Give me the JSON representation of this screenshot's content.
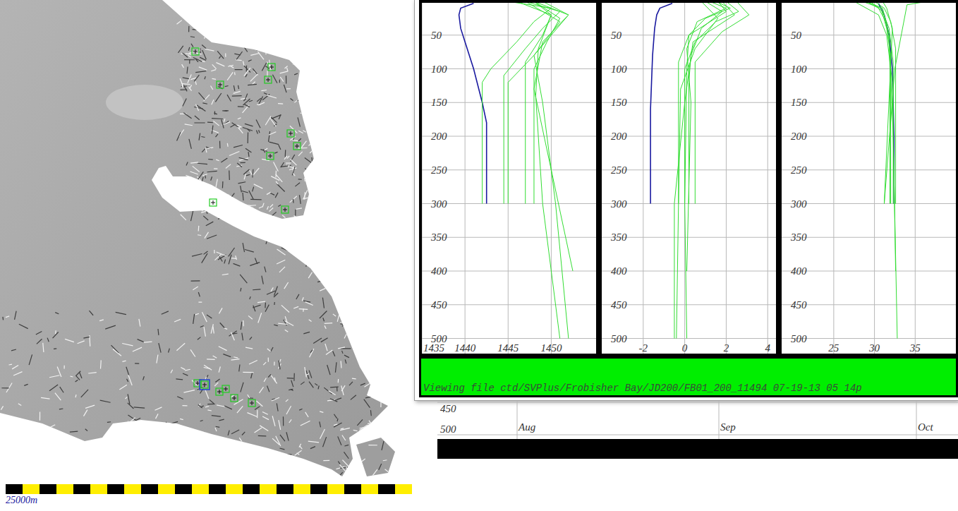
{
  "map": {
    "markers": [
      {
        "selected": false
      },
      {
        "selected": false
      },
      {
        "selected": false
      },
      {
        "selected": false
      },
      {
        "selected": false
      },
      {
        "selected": false
      },
      {
        "selected": false
      },
      {
        "selected": false
      },
      {
        "selected": false
      },
      {
        "selected": false
      },
      {
        "selected": true
      },
      {
        "selected": false
      },
      {
        "selected": false
      },
      {
        "selected": false
      },
      {
        "selected": false
      }
    ],
    "scale_bar": {
      "label": "25000m"
    }
  },
  "profile_window": {
    "panels": [
      {
        "name": "sound-speed",
        "x_min": 1435,
        "x_max": 1455.2,
        "x_ticks": [
          {
            "label": "1435",
            "value": 1435
          },
          {
            "label": "1440",
            "value": 1440
          },
          {
            "label": "1445",
            "value": 1445
          },
          {
            "label": "1450",
            "value": 1450
          }
        ],
        "depth_ticks": [
          "50",
          "100",
          "150",
          "200",
          "250",
          "300",
          "350",
          "400",
          "450",
          "500"
        ],
        "series": [
          {
            "color": "#1a1aa0",
            "depths": [
              3,
              10,
              20,
              40,
              60,
              100,
              150,
              180,
              300
            ],
            "values": [
              1441,
              1439.5,
              1439.3,
              1439.5,
              1440,
              1441,
              1442,
              1442.5,
              1442.5
            ]
          },
          {
            "color": "#33dd33",
            "depths": [
              0,
              10,
              30,
              60,
              100,
              120,
              300
            ],
            "values": [
              1445,
              1450,
              1448,
              1446,
              1443,
              1442,
              1442
            ]
          },
          {
            "color": "#33dd33",
            "depths": [
              0,
              15,
              40,
              70,
              110,
              300
            ],
            "values": [
              1447,
              1451,
              1449,
              1447,
              1444.5,
              1444.5
            ]
          },
          {
            "color": "#33dd33",
            "depths": [
              0,
              20,
              50,
              80,
              120,
              300
            ],
            "values": [
              1448,
              1452,
              1450,
              1448,
              1445,
              1445
            ]
          },
          {
            "color": "#33dd33",
            "depths": [
              0,
              20,
              50,
              90,
              300
            ],
            "values": [
              1446,
              1450,
              1449,
              1447,
              1447
            ]
          },
          {
            "color": "#33dd33",
            "depths": [
              0,
              25,
              60,
              100,
              300
            ],
            "values": [
              1448,
              1451,
              1449.5,
              1448,
              1448
            ]
          },
          {
            "color": "#33dd33",
            "depths": [
              0,
              20,
              60,
              130,
              250,
              400
            ],
            "values": [
              1449,
              1452,
              1449,
              1448,
              1450,
              1452.5
            ]
          },
          {
            "color": "#33dd33",
            "depths": [
              0,
              30,
              80,
              150,
              300,
              500
            ],
            "values": [
              1447,
              1451,
              1448,
              1449,
              1450.5,
              1452
            ]
          },
          {
            "color": "#33dd33",
            "depths": [
              0,
              20,
              70,
              140,
              300,
              500
            ],
            "values": [
              1448,
              1450,
              1448.5,
              1448.2,
              1449,
              1451
            ]
          }
        ]
      },
      {
        "name": "temperature",
        "x_min": -4,
        "x_max": 4.4,
        "x_ticks": [
          {
            "label": "-2",
            "value": -2
          },
          {
            "label": "0",
            "value": 0
          },
          {
            "label": "2",
            "value": 2
          },
          {
            "label": "4",
            "value": 4
          }
        ],
        "depth_ticks": [
          "50",
          "100",
          "150",
          "200",
          "250",
          "300",
          "350",
          "400",
          "450",
          "500"
        ],
        "series": [
          {
            "color": "#1a1aa0",
            "depths": [
              3,
              10,
              20,
              40,
              80,
              120,
              160,
              300
            ],
            "values": [
              -0.6,
              -1.2,
              -1.35,
              -1.45,
              -1.55,
              -1.6,
              -1.65,
              -1.65
            ]
          },
          {
            "color": "#33dd33",
            "depths": [
              0,
              10,
              25,
              50,
              90,
              300
            ],
            "values": [
              1.5,
              2.2,
              1.0,
              0.2,
              -0.3,
              -0.3
            ]
          },
          {
            "color": "#33dd33",
            "depths": [
              0,
              15,
              30,
              60,
              100,
              300
            ],
            "values": [
              2.0,
              2.6,
              1.5,
              0.5,
              0,
              0
            ]
          },
          {
            "color": "#33dd33",
            "depths": [
              0,
              15,
              40,
              80,
              120,
              300
            ],
            "values": [
              1.0,
              1.8,
              0.8,
              0.3,
              0.2,
              0.2
            ]
          },
          {
            "color": "#33dd33",
            "depths": [
              0,
              20,
              45,
              90,
              300
            ],
            "values": [
              2.5,
              3.1,
              1.8,
              0.5,
              0.5
            ]
          },
          {
            "color": "#33dd33",
            "depths": [
              0,
              10,
              30,
              70,
              150,
              400
            ],
            "values": [
              1.2,
              2.0,
              0.6,
              0.1,
              0.3,
              0.1
            ]
          },
          {
            "color": "#33dd33",
            "depths": [
              0,
              20,
              60,
              150,
              300,
              500
            ],
            "values": [
              1.8,
              2.4,
              0.4,
              0,
              -0.5,
              -0.5
            ]
          },
          {
            "color": "#33dd33",
            "depths": [
              0,
              25,
              70,
              130,
              300,
              500
            ],
            "values": [
              0.8,
              1.6,
              0.5,
              -0.2,
              -0.3,
              -0.4
            ]
          },
          {
            "color": "#33dd33",
            "depths": [
              0,
              15,
              50,
              100,
              300,
              500
            ],
            "values": [
              1.6,
              2.0,
              0.2,
              0.1,
              0,
              0.1
            ]
          }
        ]
      },
      {
        "name": "salinity",
        "x_min": 18.6,
        "x_max": 40,
        "x_ticks": [
          {
            "label": "25",
            "value": 25
          },
          {
            "label": "30",
            "value": 30
          },
          {
            "label": "35",
            "value": 35
          }
        ],
        "depth_ticks": [
          "50",
          "100",
          "150",
          "200",
          "250",
          "300",
          "350",
          "400",
          "450",
          "500"
        ],
        "series": [
          {
            "color": "#1a1aa0",
            "depths": [
              3,
              20,
              50,
              100,
              150,
              200,
              300
            ],
            "values": [
              30.5,
              31.2,
              31.8,
              32.2,
              32.3,
              32.4,
              32.4
            ]
          },
          {
            "color": "#33dd33",
            "depths": [
              0,
              10,
              30,
              60,
              100,
              300
            ],
            "values": [
              29,
              30.5,
              31.4,
              31.8,
              31.9,
              31.9
            ]
          },
          {
            "color": "#33dd33",
            "depths": [
              0,
              10,
              40,
              80,
              300
            ],
            "values": [
              28.5,
              30.8,
              31.5,
              32,
              32
            ]
          },
          {
            "color": "#33dd33",
            "depths": [
              0,
              15,
              40,
              90,
              300
            ],
            "values": [
              29.5,
              31,
              31.8,
              32.3,
              32.3
            ]
          },
          {
            "color": "#33dd33",
            "depths": [
              0,
              10,
              30,
              70,
              300
            ],
            "values": [
              30,
              31.2,
              32,
              32.6,
              32.6
            ]
          },
          {
            "color": "#33dd33",
            "depths": [
              0,
              20,
              50,
              120,
              400
            ],
            "values": [
              27.5,
              30.5,
              31.5,
              32.2,
              32.6
            ]
          },
          {
            "color": "#33dd33",
            "depths": [
              0,
              10,
              50,
              200,
              500
            ],
            "values": [
              29,
              31,
              31.8,
              32.3,
              32.8
            ]
          },
          {
            "color": "#33dd33",
            "depths": [
              0,
              5,
              100,
              300
            ],
            "values": [
              36.5,
              34,
              32.5,
              31.2
            ]
          },
          {
            "color": "#33dd33",
            "depths": [
              0,
              10,
              40,
              300
            ],
            "values": [
              31,
              31.5,
              32.2,
              31.2
            ]
          }
        ]
      }
    ],
    "status": "Viewing file ctd/SVPlus/Frobisher Bay/JD200/FB01_200_11494 07-19-13 05 14p"
  },
  "timeline": {
    "depth_ticks": [
      "450",
      "500"
    ],
    "months": [
      "Aug",
      "Sep",
      "Oct"
    ]
  }
}
